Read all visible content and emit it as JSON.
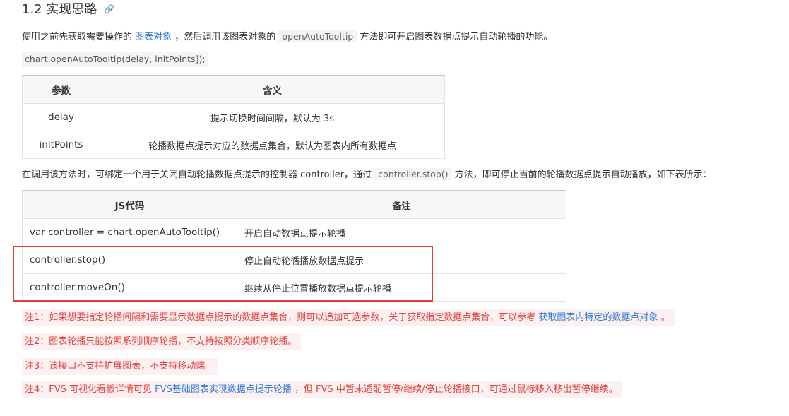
{
  "heading": {
    "title": "1.2 实现思路",
    "link_icon": "🔗"
  },
  "intro": {
    "text_before": "使用之前先获取需要操作的 ",
    "link": "图表对象",
    "text_middle": " ，然后调用该图表对象的 ",
    "code": "openAutoTooltip",
    "text_after": " 方法即可开启图表数据点提示自动轮播的功能。"
  },
  "code_sample": "chart.openAutoTooltip(delay, initPoints]);",
  "params_table": {
    "headers": [
      "参数",
      "含义"
    ],
    "rows": [
      [
        "delay",
        "提示切换时间间隔，默认为 3s"
      ],
      [
        "initPoints",
        "轮播数据点提示对应的数据点集合，默认为图表内所有数据点"
      ]
    ]
  },
  "controller_para": {
    "text_before": "在调用该方法时，可绑定一个用于关闭自动轮播数据点提示的控制器 controller，通过 ",
    "code": "controller.stop()",
    "text_after": " 方法，即可停止当前的轮播数据点提示自动播放，如下表所示："
  },
  "js_table": {
    "headers": [
      "JS代码",
      "备注"
    ],
    "rows": [
      [
        "var controller = chart.openAutoTooltip()",
        "开启自动数据点提示轮播"
      ],
      [
        "controller.stop()",
        "停止自动轮循播放数据点提示"
      ],
      [
        "controller.moveOn()",
        "继续从停止位置播放数据点提示轮播"
      ]
    ]
  },
  "notes": {
    "note1": {
      "text_before": "注1：如果想要指定轮播间隔和需要显示数据点提示的数据点集合，则可以追加可选参数，关于获取指定数据点集合，可以参考 ",
      "link": "获取图表内特定的数据点对象",
      "text_after": " 。"
    },
    "note2": {
      "text": "注2：图表轮播只能按照系列顺序轮播，不支持按照分类顺序轮播。"
    },
    "note3": {
      "text": "注3：该接口不支持扩展图表，不支持移动端。"
    },
    "note4": {
      "text_before": "注4：FVS 可视化看板详情可见 ",
      "link": "FVS基础图表实现数据点提示轮播",
      "text_after": " ，但 FVS 中暂未适配暂停/继续/停止轮播接口，可通过鼠标移入移出暂停继续。"
    }
  },
  "colors": {
    "link": "#2f7bd6",
    "note_text": "#e0433f",
    "note_bg": "#fdf0f0",
    "highlight_border": "#e43b3b"
  }
}
